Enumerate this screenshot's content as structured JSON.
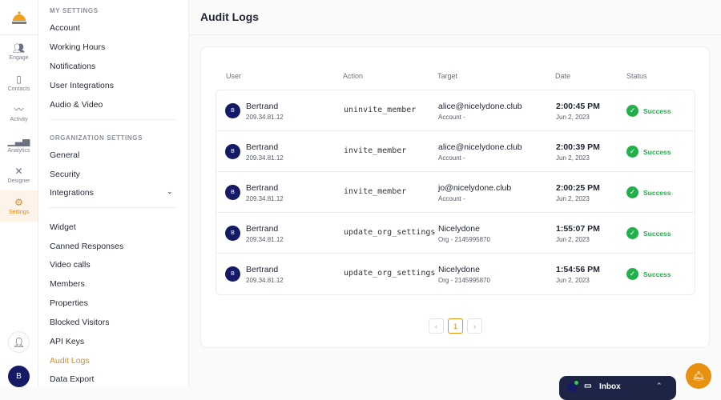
{
  "rail": {
    "items": [
      {
        "label": "Engage",
        "icon": "people-icon"
      },
      {
        "label": "Contacts",
        "icon": "book-icon"
      },
      {
        "label": "Activity",
        "icon": "pulse-icon"
      },
      {
        "label": "Analytics",
        "icon": "bar-chart-icon"
      },
      {
        "label": "Designer",
        "icon": "tools-icon"
      },
      {
        "label": "Settings",
        "icon": "gear-icon"
      }
    ],
    "avatar": "B"
  },
  "sidebar": {
    "my_header": "MY SETTINGS",
    "my_items": [
      "Account",
      "Working Hours",
      "Notifications",
      "User Integrations",
      "Audio & Video"
    ],
    "org_header": "ORGANIZATION SETTINGS",
    "org_items": [
      "General",
      "Security",
      "Integrations"
    ],
    "other_items": [
      "Widget",
      "Canned Responses",
      "Video calls",
      "Members",
      "Properties",
      "Blocked Visitors",
      "API Keys",
      "Audit Logs",
      "Data Export"
    ]
  },
  "page": {
    "title": "Audit Logs"
  },
  "table": {
    "headers": [
      "User",
      "Action",
      "Target",
      "Date",
      "Status"
    ],
    "rows": [
      {
        "initial": "B",
        "user": "Bertrand",
        "ip": "209.34.81.12",
        "action": "uninvite_member",
        "target": "alice@nicelydone.club",
        "target_sub": "Account -",
        "time": "2:00:45 PM",
        "date": "Jun 2, 2023",
        "status": "Success"
      },
      {
        "initial": "B",
        "user": "Bertrand",
        "ip": "209.34.81.12",
        "action": "invite_member",
        "target": "alice@nicelydone.club",
        "target_sub": "Account -",
        "time": "2:00:39 PM",
        "date": "Jun 2, 2023",
        "status": "Success"
      },
      {
        "initial": "B",
        "user": "Bertrand",
        "ip": "209.34.81.12",
        "action": "invite_member",
        "target": "jo@nicelydone.club",
        "target_sub": "Account -",
        "time": "2:00:25 PM",
        "date": "Jun 2, 2023",
        "status": "Success"
      },
      {
        "initial": "B",
        "user": "Bertrand",
        "ip": "209.34.81.12",
        "action": "update_org_settings",
        "target": "Nicelydone",
        "target_sub": "Org - 2145995870",
        "time": "1:55:07 PM",
        "date": "Jun 2, 2023",
        "status": "Success"
      },
      {
        "initial": "B",
        "user": "Bertrand",
        "ip": "209.34.81.12",
        "action": "update_org_settings",
        "target": "Nicelydone",
        "target_sub": "Org - 2145995870",
        "time": "1:54:56 PM",
        "date": "Jun 2, 2023",
        "status": "Success"
      }
    ]
  },
  "pagination": {
    "current": "1"
  },
  "inbox": {
    "label": "Inbox"
  },
  "colors": {
    "accent": "#e08a1a",
    "success": "#22b04b",
    "navy": "#141a66"
  }
}
